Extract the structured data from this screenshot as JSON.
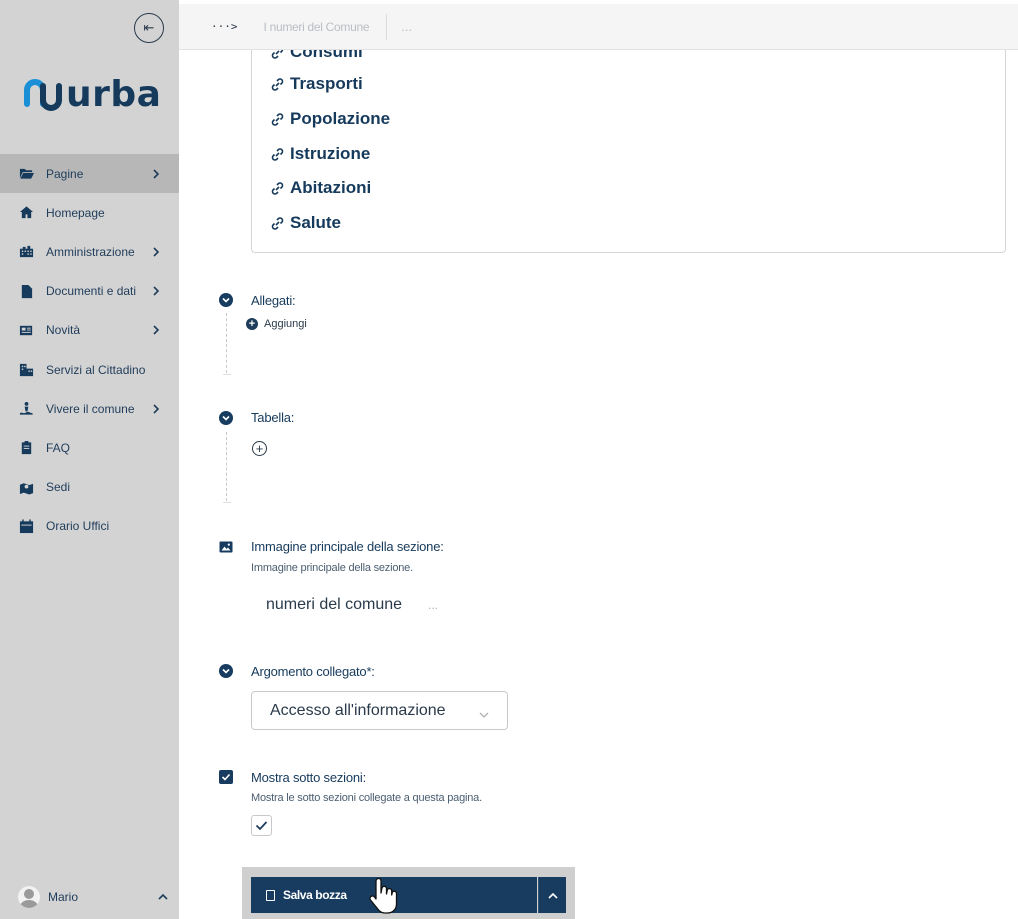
{
  "sidebar": {
    "collapse_glyph": "⇤",
    "logo_text": "urba",
    "items": [
      {
        "label": "Pagine",
        "icon": "folder-open-icon",
        "has_submenu": true,
        "active": true
      },
      {
        "label": "Homepage",
        "icon": "home-icon",
        "has_submenu": false
      },
      {
        "label": "Amministrazione",
        "icon": "building-icon",
        "has_submenu": true
      },
      {
        "label": "Documenti e dati",
        "icon": "file-icon",
        "has_submenu": true
      },
      {
        "label": "Novità",
        "icon": "newspaper-icon",
        "has_submenu": true
      },
      {
        "label": "Servizi al Cittadino",
        "icon": "city-icon",
        "has_submenu": false
      },
      {
        "label": "Vivere il comune",
        "icon": "person-swimming-icon",
        "has_submenu": true
      },
      {
        "label": "FAQ",
        "icon": "clipboard-icon",
        "has_submenu": false
      },
      {
        "label": "Sedi",
        "icon": "map-location-icon",
        "has_submenu": false
      },
      {
        "label": "Orario Uffici",
        "icon": "calendar-icon",
        "has_submenu": false
      }
    ],
    "user": {
      "name": "Mario"
    }
  },
  "topbar": {
    "arrow": "···>",
    "breadcrumb": "I numeri del Comune",
    "more": "..."
  },
  "links": [
    {
      "label": "Consumi"
    },
    {
      "label": "Trasporti"
    },
    {
      "label": "Popolazione"
    },
    {
      "label": "Istruzione"
    },
    {
      "label": "Abitazioni"
    },
    {
      "label": "Salute"
    }
  ],
  "sections": {
    "allegati": {
      "title": "Allegati:",
      "add_label": "Aggiungi"
    },
    "tabella": {
      "title": "Tabella:",
      "add_glyph": "+"
    },
    "immagine": {
      "title": "Immagine principale della sezione:",
      "description": "Immagine principale della sezione.",
      "caption": "numeri del comune",
      "dots": "..."
    },
    "argomento": {
      "title": "Argomento collegato*:",
      "selected": "Accesso all'informazione"
    },
    "sottosezioni": {
      "title": "Mostra sotto sezioni:",
      "description": "Mostra le sotto sezioni collegate a questa pagina.",
      "checked": true
    }
  },
  "actions": {
    "save_label": "Salva bozza"
  },
  "colors": {
    "primary": "#173c5f",
    "sidebar_bg": "#d3d3d3",
    "sidebar_active": "#b7b7b7",
    "logo_accent": "#1a8fd6"
  }
}
